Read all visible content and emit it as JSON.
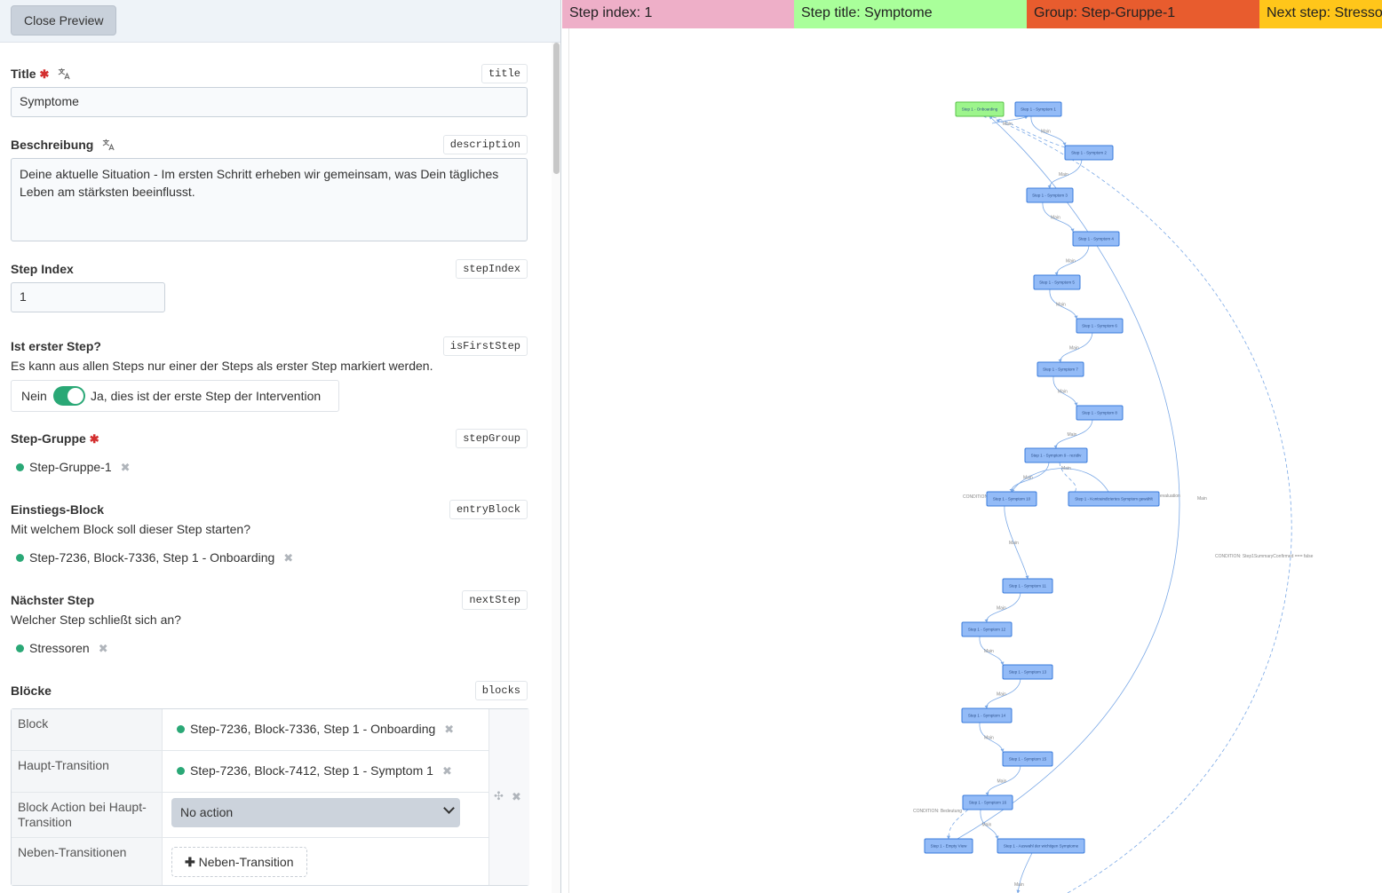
{
  "toolbar": {
    "close_label": "Close Preview"
  },
  "fields": {
    "title": {
      "label": "Title",
      "key": "title",
      "value": "Symptome"
    },
    "description": {
      "label": "Beschreibung",
      "key": "description",
      "value": "Deine aktuelle Situation - Im ersten Schritt erheben wir gemeinsam, was Dein tägliches Leben am stärksten beeinflusst."
    },
    "stepIndex": {
      "label": "Step Index",
      "key": "stepIndex",
      "value": "1"
    },
    "isFirstStep": {
      "label": "Ist erster Step?",
      "key": "isFirstStep",
      "help": "Es kann aus allen Steps nur einer der Steps als erster Step markiert werden.",
      "off_label": "Nein",
      "on_label": "Ja, dies ist der erste Step der Intervention"
    },
    "stepGroup": {
      "label": "Step-Gruppe",
      "key": "stepGroup",
      "value": "Step-Gruppe-1"
    },
    "entryBlock": {
      "label": "Einstiegs-Block",
      "key": "entryBlock",
      "help": "Mit welchem Block soll dieser Step starten?",
      "value": "Step-7236, Block-7336, Step 1 - Onboarding"
    },
    "nextStep": {
      "label": "Nächster Step",
      "key": "nextStep",
      "help": "Welcher Step schließt sich an?",
      "value": "Stressoren"
    },
    "blocks": {
      "label": "Blöcke",
      "key": "blocks",
      "rows": {
        "block": {
          "label": "Block",
          "value": "Step-7236, Block-7336, Step 1 - Onboarding"
        },
        "main": {
          "label": "Haupt-Transition",
          "value": "Step-7236, Block-7412, Step 1 - Symptom 1"
        },
        "action": {
          "label": "Block Action bei Haupt-Transition",
          "value": "No action"
        },
        "side": {
          "label": "Neben-Transitionen",
          "button": "Neben-Transition"
        }
      }
    }
  },
  "banners": [
    {
      "text": "Step index: 1",
      "color": "#eeafc8"
    },
    {
      "text": "Step title: Symptome",
      "color": "#a9ff9a"
    },
    {
      "text": "Group: Step-Gruppe-1",
      "color": "#e85c2e"
    },
    {
      "text": "Next step: Stressoren",
      "color": "#ffc61a"
    }
  ],
  "graph": {
    "nodes": [
      "Step 1 - Onboarding",
      "Step 1 - Symptom 1",
      "Step 1 - Symptom 2",
      "Step 1 - Symptom 3",
      "Step 1 - Symptom 4",
      "Step 1 - Symptom 5",
      "Step 1 - Symptom 6",
      "Step 1 - Symptom 7",
      "Step 1 - Symptom 8",
      "Step 1 - Symptom 9 - rezidiv",
      "Step 1 - Symptom 10",
      "Step 1 - Kontraindiziertes Symptom gewählt",
      "Step 1 - Symptom 11",
      "Step 1 - Symptom 12",
      "Step 1 - Symptom 13",
      "Step 1 - Symptom 14",
      "Step 1 - Symptom 15",
      "Step 1 - Symptom 16",
      "Step 1 - Empty View",
      "Step 1 - Auswahl der wichtigen Symptome"
    ],
    "edge_label_main": "Main",
    "condition_label": "CONDITION: Step1SummaryConfirmed === false",
    "condition_label_2": "CONDITION",
    "condition_label_3": "CONDITION: Bedeutung"
  },
  "colors": {
    "accent": "#2aa876",
    "node_fill": "#93bbf7",
    "node_stroke": "#3a7bdb",
    "node_start_fill": "#9df58c",
    "edge": "#7aa8e6"
  }
}
